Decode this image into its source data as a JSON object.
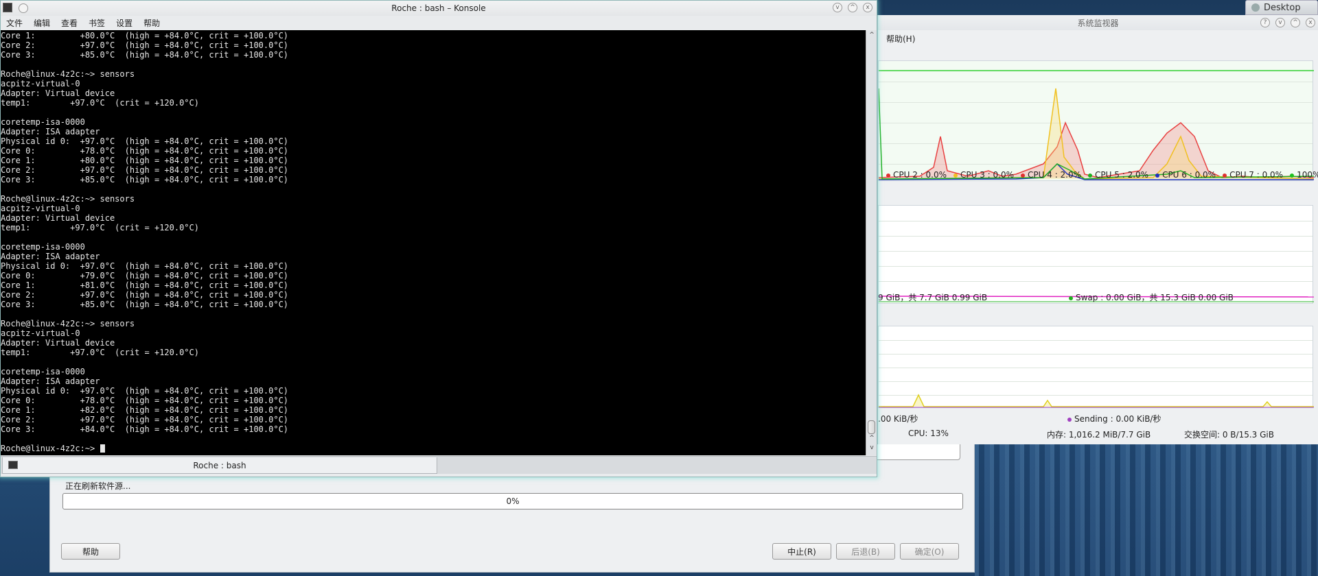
{
  "desktop": {
    "button_label": "Desktop"
  },
  "konsole": {
    "title": "Roche : bash – Konsole",
    "menu": [
      "文件",
      "编辑",
      "查看",
      "书签",
      "设置",
      "帮助"
    ],
    "tab_label": "Roche : bash",
    "terminal_lines": [
      "Core 1:         +80.0°C  (high = +84.0°C, crit = +100.0°C)",
      "Core 2:         +97.0°C  (high = +84.0°C, crit = +100.0°C)",
      "Core 3:         +85.0°C  (high = +84.0°C, crit = +100.0°C)",
      "",
      "Roche@linux-4z2c:~> sensors",
      "acpitz-virtual-0",
      "Adapter: Virtual device",
      "temp1:        +97.0°C  (crit = +120.0°C)",
      "",
      "coretemp-isa-0000",
      "Adapter: ISA adapter",
      "Physical id 0:  +97.0°C  (high = +84.0°C, crit = +100.0°C)",
      "Core 0:         +78.0°C  (high = +84.0°C, crit = +100.0°C)",
      "Core 1:         +80.0°C  (high = +84.0°C, crit = +100.0°C)",
      "Core 2:         +97.0°C  (high = +84.0°C, crit = +100.0°C)",
      "Core 3:         +85.0°C  (high = +84.0°C, crit = +100.0°C)",
      "",
      "Roche@linux-4z2c:~> sensors",
      "acpitz-virtual-0",
      "Adapter: Virtual device",
      "temp1:        +97.0°C  (crit = +120.0°C)",
      "",
      "coretemp-isa-0000",
      "Adapter: ISA adapter",
      "Physical id 0:  +97.0°C  (high = +84.0°C, crit = +100.0°C)",
      "Core 0:         +79.0°C  (high = +84.0°C, crit = +100.0°C)",
      "Core 1:         +81.0°C  (high = +84.0°C, crit = +100.0°C)",
      "Core 2:         +97.0°C  (high = +84.0°C, crit = +100.0°C)",
      "Core 3:         +85.0°C  (high = +84.0°C, crit = +100.0°C)",
      "",
      "Roche@linux-4z2c:~> sensors",
      "acpitz-virtual-0",
      "Adapter: Virtual device",
      "temp1:        +97.0°C  (crit = +120.0°C)",
      "",
      "coretemp-isa-0000",
      "Adapter: ISA adapter",
      "Physical id 0:  +97.0°C  (high = +84.0°C, crit = +100.0°C)",
      "Core 0:         +78.0°C  (high = +84.0°C, crit = +100.0°C)",
      "Core 1:         +82.0°C  (high = +84.0°C, crit = +100.0°C)",
      "Core 2:         +97.0°C  (high = +84.0°C, crit = +100.0°C)",
      "Core 3:         +84.0°C  (high = +84.0°C, crit = +100.0°C)",
      "",
      "Roche@linux-4z2c:~> "
    ]
  },
  "sysmon": {
    "title": "系统监视器",
    "menu_help": "帮助(H)",
    "cpu_legend": [
      {
        "label": "CPU 2 : 0.0%",
        "color": "#e03030"
      },
      {
        "label": "CPU 3 : 0.0%",
        "color": "#f0c020"
      },
      {
        "label": "CPU 4 : 2.0%",
        "color": "#e03030"
      },
      {
        "label": "CPU 5 : 2.0%",
        "color": "#20b020"
      },
      {
        "label": "CPU 6 : 0.0%",
        "color": "#2030c0"
      },
      {
        "label": "CPU 7 : 0.0%",
        "color": "#e03030"
      },
      {
        "label": "100%",
        "color": "#20c020"
      }
    ],
    "memory_legend_left": "9 GiB，共 7.7 GiB 0.99 GiB",
    "swap_legend": "Swap : 0.00 GiB，共 15.3 GiB 0.00 GiB",
    "swap_color": "#20b020",
    "net_legend_left": ".00 KiB/秒",
    "net_sending": "Sending : 0.00 KiB/秒",
    "net_sending_color": "#a040c0",
    "status_cpu": "CPU: 13%",
    "status_mem": "内存: 1,016.2 MiB/7.7 GiB",
    "status_swap": "交换空间: 0 B/15.3 GiB"
  },
  "packagekit": {
    "status": "正在刷新软件源...",
    "progress": "0%",
    "help_button": "帮助",
    "abort_button": "中止(R)",
    "back_button": "后退(B)",
    "ok_button": "确定(O)"
  }
}
